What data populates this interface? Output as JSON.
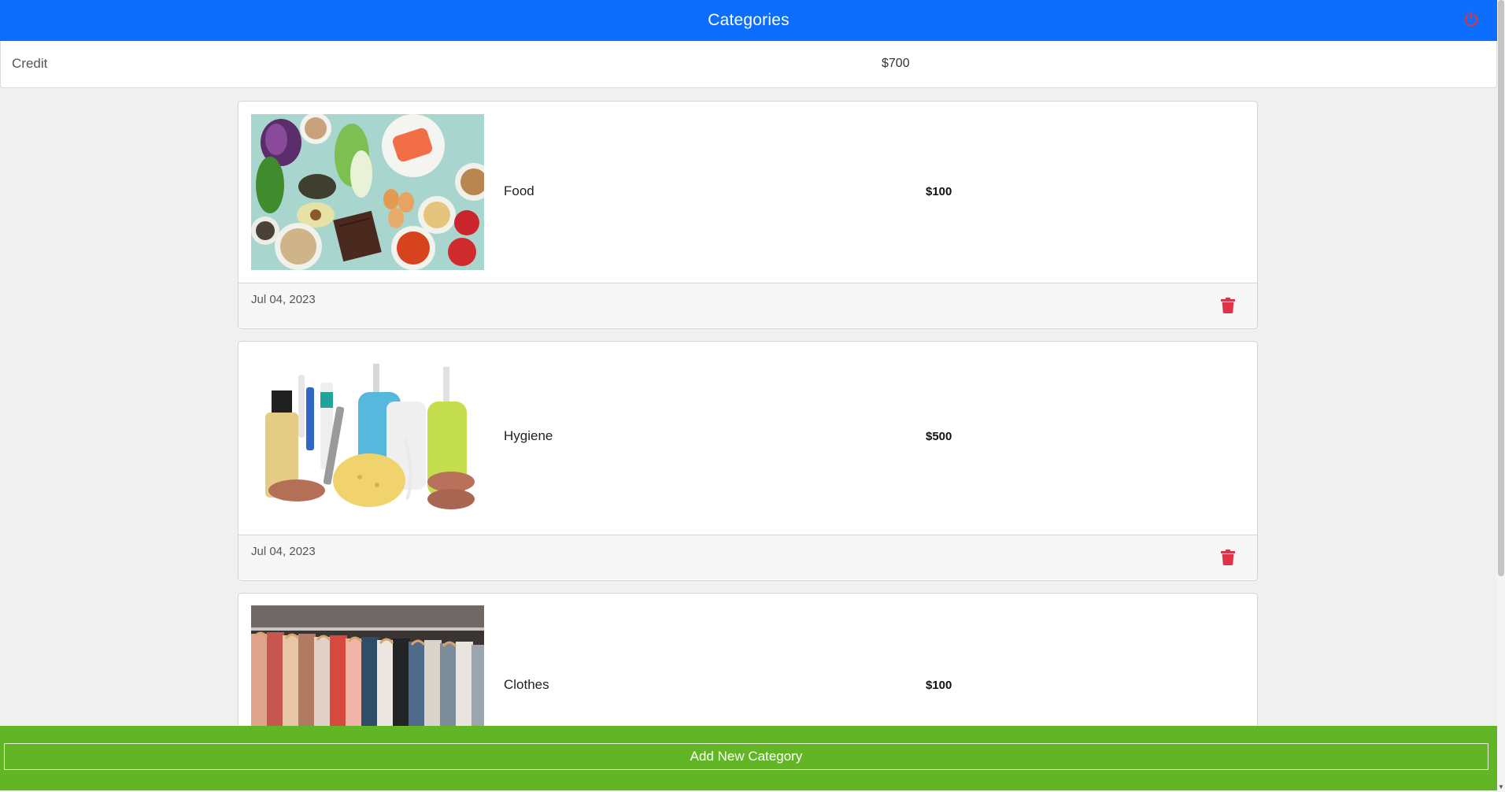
{
  "header": {
    "title": "Categories",
    "power_icon": "power-icon",
    "power_color": "#dc3545",
    "background": "#0d6efd"
  },
  "credit": {
    "label": "Credit",
    "amount": "$700"
  },
  "categories": [
    {
      "name": "Food",
      "amount": "$100",
      "date": "Jul 04, 2023",
      "image": "food-image",
      "delete_icon": "trash-icon"
    },
    {
      "name": "Hygiene",
      "amount": "$500",
      "date": "Jul 04, 2023",
      "image": "hygiene-image",
      "delete_icon": "trash-icon"
    },
    {
      "name": "Clothes",
      "amount": "$100",
      "image": "clothes-image"
    }
  ],
  "footer": {
    "add_label": "Add New Category",
    "background": "#62b524"
  },
  "colors": {
    "delete": "#dc3545"
  }
}
